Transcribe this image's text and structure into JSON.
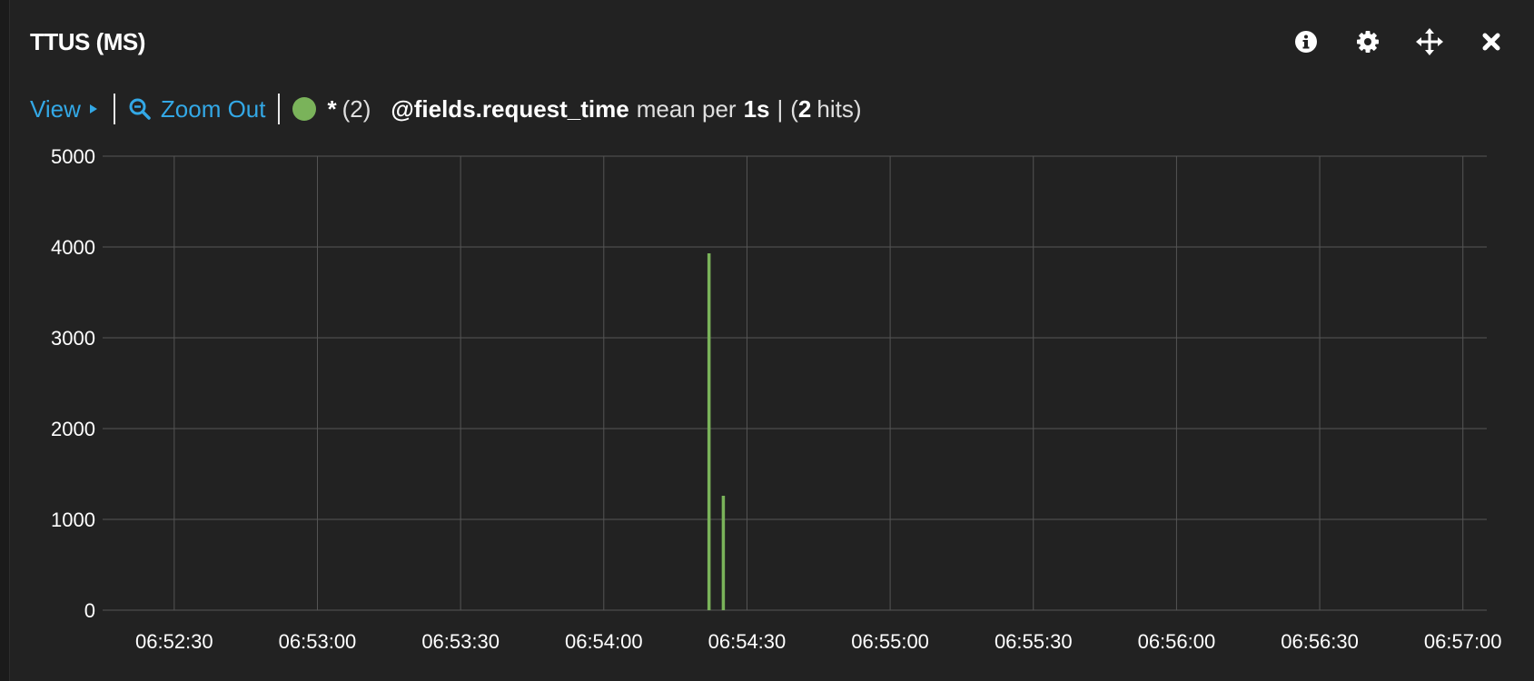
{
  "panel": {
    "title": "TTUS (MS)",
    "icons": [
      "info-icon",
      "gear-icon",
      "move-icon",
      "close-icon"
    ]
  },
  "toolbar": {
    "view_label": "View",
    "zoom_label": "Zoom Out",
    "legend_marker": "*",
    "legend_count": "(2)",
    "field": "@fields.request_time",
    "mean_per": "mean per",
    "interval": "1s",
    "pipe": "|",
    "hits_open": "(",
    "hits_count": "2",
    "hits_label": "hits)"
  },
  "colors": {
    "series": "#7ab35a",
    "link": "#33a8e6",
    "background": "#222222",
    "grid": "#555555"
  },
  "chart_data": {
    "type": "bar",
    "title": "",
    "xlabel": "",
    "ylabel": "",
    "ylim": [
      0,
      5000
    ],
    "yticks": [
      0,
      1000,
      2000,
      3000,
      4000,
      5000
    ],
    "xlim": [
      "06:52:15",
      "06:57:05"
    ],
    "xticks": [
      "06:52:30",
      "06:53:00",
      "06:53:30",
      "06:54:00",
      "06:54:30",
      "06:55:00",
      "06:55:30",
      "06:56:00",
      "06:56:30",
      "06:57:00"
    ],
    "grid": true,
    "series": [
      {
        "values": [
          {
            "x": "06:54:22",
            "y": 3930
          },
          {
            "x": "06:54:25",
            "y": 1260
          }
        ]
      }
    ]
  }
}
